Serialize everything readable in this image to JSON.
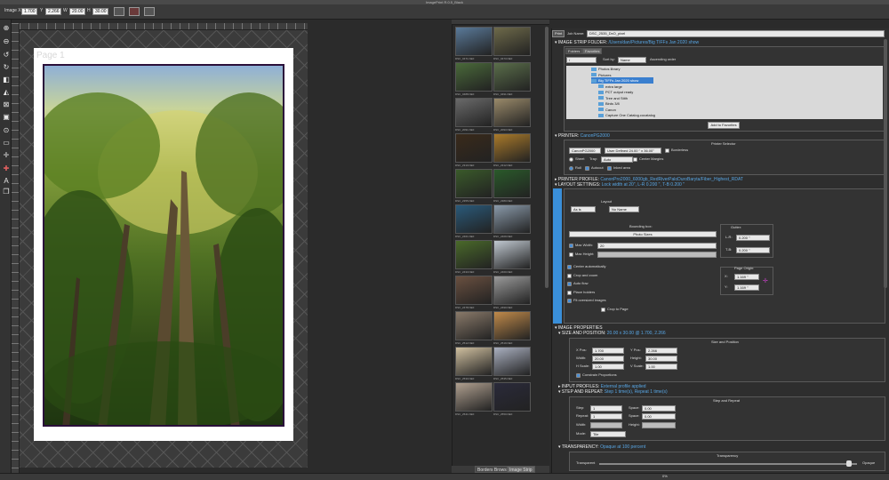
{
  "window": {
    "title": "ImagePrint R.0.5_Black"
  },
  "toolbar": {
    "image_x_label": "Image X",
    "image_x_value": "1.700",
    "y_label": "Y",
    "y_value": "2.266",
    "w_label": "W",
    "w_value": "20.00",
    "h_label": "H",
    "h_value": "30.00"
  },
  "canvas": {
    "page_label": "Page 1"
  },
  "strip": {
    "thumb_labels": [
      "DSC_0471.NEF",
      "DSC_0473.NEF",
      "DSC_0488.NEF",
      "DSC_0491.NEF",
      "DSC_2091.NEF",
      "DSC_2093.NEF",
      "DSC_2310.NEF",
      "DSC_2312.NEF",
      "DSC_2355.NEF",
      "DSC_2380.NEF",
      "DSC_2401.NEF",
      "DSC_2409.NEF",
      "DSC_2433.NEF",
      "DSC_2460.NEF",
      "DSC_2478.NEF",
      "DSC_2490.NEF",
      "DSC_2512.NEF",
      "DSC_2519.NEF",
      "DSC_2530.NEF",
      "DSC_2535.NEF",
      "DSC_2541.NEF",
      "DSC_2550.NEF"
    ],
    "tab_border": "Borders Browser",
    "tab_strip": "Image Strip"
  },
  "panel": {
    "print_label": "Print",
    "job_name_label": "Job Name:",
    "job_name_value": "DSC_2535_DxO_pixel",
    "image_strip_folder": {
      "label": "IMAGE STRIP FOLDER:",
      "value": "/Users/dan/Pictures/Big TIFFs Jan 2020 show"
    },
    "folder_tabs": [
      "Folders",
      "Favorites"
    ],
    "path_select": "/",
    "sort_label": "Sort by:",
    "sort_value": "Name",
    "order_value": "Ascending order",
    "tree": [
      "Photos library",
      "Pictures",
      "Big TIFFs Jan 2020 show",
      "extra large",
      "PCT output ready",
      "Tree and Stith",
      "Birds 3/8",
      "Canon",
      "Capture One Catalog.cocatalog"
    ],
    "add_favorites": "Add to Favorites",
    "printer": {
      "label": "PRINTER:",
      "value": "CanonPG2000"
    },
    "printer_selector": "Printer Selector",
    "printer_model": "CanonPG2000",
    "paper_size": "User Defined 24.00 \" x 36.00\"",
    "borderless": "Borderless",
    "sheet": "Sheet",
    "tray_label": "Tray:",
    "tray_value": "Auto",
    "center_margins": "Center Margins",
    "roll": "Roll",
    "autocut": "Autocut",
    "inked_area": "Inked area",
    "printer_profile": {
      "label": "PRINTER PROFILE:",
      "value": "CanonPro2000_6000gb_RedRiverPaloDuroBaryta/Fiber_Highest_RDAT"
    },
    "layout_settings": {
      "label": "LAYOUT SETTINGS:",
      "value": "Lock width at 20\", L-R 0.200 \", T-B 0.200 \""
    },
    "layout": {
      "title": "Layout",
      "as_is": "As is",
      "no_name": "No Name"
    },
    "bounding_box": {
      "title": "Bounding box:",
      "value": "Photo Sizes",
      "max_width": "Max Width:",
      "max_width_value": "20",
      "max_height": "Max Height:"
    },
    "gutter": {
      "title": "Gutter:",
      "lr": "L-R:",
      "lr_value": "0.200 \"",
      "tb": "T-B:",
      "tb_value": "0.200 \""
    },
    "options": [
      "Center automatically",
      "Crop and zoom",
      "Auto flow",
      "Place holders",
      "Fit oversized images"
    ],
    "crop_to_page": "Crop to Page",
    "page_origin": {
      "title": "Page Origin:",
      "x": "X:",
      "x_value": "1.169 \"",
      "y": "Y:",
      "y_value": "1.169 \""
    },
    "image_properties": {
      "label": "IMAGE PROPERTIES"
    },
    "size_and_position": {
      "label": "SIZE AND POSITION:",
      "value": "20.00 x 30.00 @ 1.700, 2.266"
    },
    "sp_box": {
      "title": "Size and Position",
      "xpos": "X Pos:",
      "xpos_value": "1.700",
      "ypos": "Y Pos:",
      "ypos_value": "2.266",
      "width": "Width:",
      "width_value": "20.00",
      "height": "Height:",
      "height_value": "30.00",
      "hscale": "H Scale:",
      "hscale_value": "1.00",
      "vscale": "V Scale:",
      "vscale_value": "1.00",
      "constrain": "Constrain Proportions"
    },
    "input_profiles": {
      "label": "INPUT PROFILES:",
      "value": "External profile applied"
    },
    "step_repeat": {
      "label": "STEP AND REPEAT:",
      "value": "Step 1 time(s), Repeat 1 time(s)"
    },
    "sr_box": {
      "title": "Step and Repeat",
      "step": "Step:",
      "step_value": "1",
      "space1": "Space:",
      "space1_value": "0.00",
      "repeat": "Repeat:",
      "repeat_value": "1",
      "space2": "Space:",
      "space2_value": "0.00",
      "width": "Width:",
      "height": "Height:",
      "mode": "Mode:",
      "mode_value": "Tile"
    },
    "transparency": {
      "label": "TRANSPARENCY:",
      "value": "Opaque at 100 percent"
    },
    "tr_box": {
      "title": "Transparency",
      "left": "Transparent",
      "right": "Opaque",
      "level": 0.97
    }
  },
  "status": {
    "zoom": "0%"
  }
}
